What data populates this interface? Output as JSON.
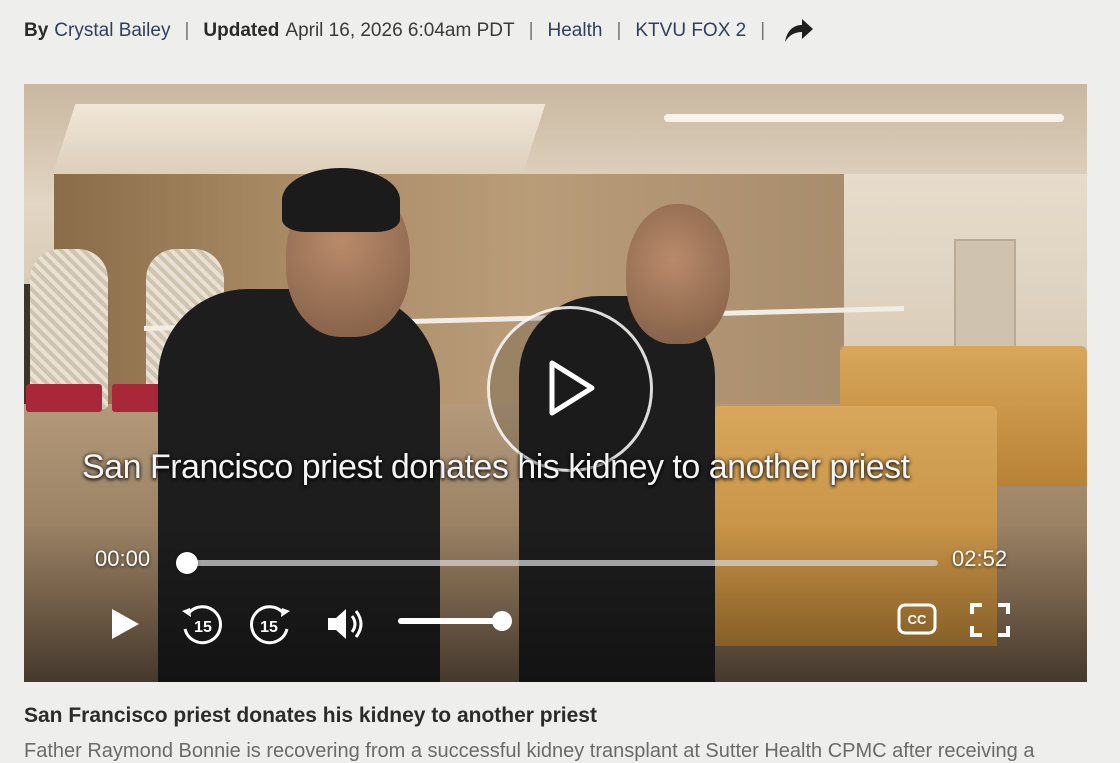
{
  "byline": {
    "by_label": "By",
    "author": "Crystal Bailey",
    "separator": "|",
    "updated_label": "Updated",
    "updated_date": "April 16, 2026 6:04am PDT",
    "category": "Health",
    "source": "KTVU FOX 2",
    "share_icon": "share-arrow-icon"
  },
  "video": {
    "caption": "San Francisco priest donates his kidney to another priest",
    "current_time": "00:00",
    "duration": "02:52",
    "progress_fraction": 0.0,
    "volume_fraction": 1.0,
    "skip_back_label": "15",
    "skip_forward_label": "15",
    "cc_label": "CC",
    "icons": {
      "big_play": "play-circle-icon",
      "play": "play-icon",
      "skip_back": "rewind-15-icon",
      "skip_forward": "forward-15-icon",
      "volume": "volume-icon",
      "captions": "closed-captions-icon",
      "fullscreen": "fullscreen-icon"
    }
  },
  "article": {
    "title": "San Francisco priest donates his kidney to another priest",
    "snippet": "Father Raymond Bonnie is recovering from a successful kidney transplant at Sutter Health CPMC after receiving a"
  },
  "colors": {
    "page_background": "#eeeeec",
    "link": "#2f3f5c",
    "control_white": "#ffffff"
  }
}
